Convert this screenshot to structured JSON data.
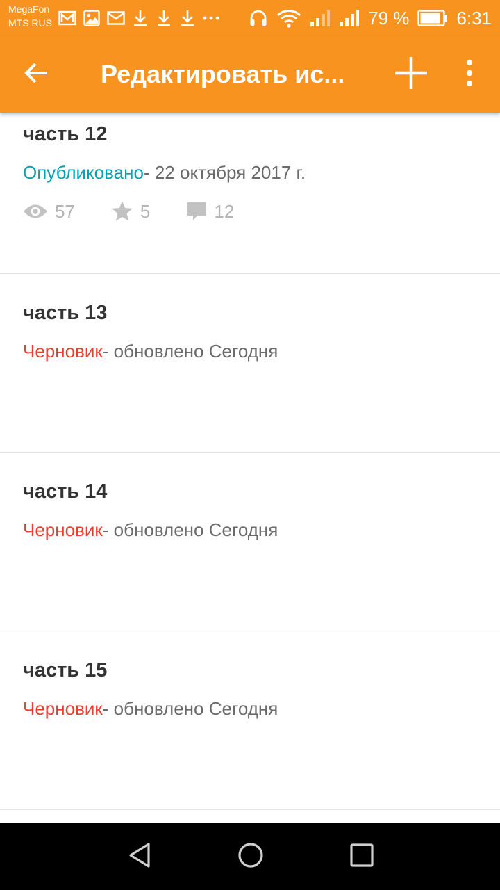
{
  "status_bar": {
    "carrier_1": "MegaFon",
    "carrier_2": "MTS RUS",
    "battery_percent": "79 %",
    "time": "6:31",
    "icons": [
      "gmail-icon",
      "image-icon",
      "mail-icon",
      "download-icon",
      "download-icon",
      "download-icon",
      "more-notifications-icon",
      "headset-icon",
      "wifi-icon",
      "signal-icon",
      "signal-icon",
      "battery-icon"
    ]
  },
  "toolbar": {
    "title": "Редактировать ис...",
    "icons": [
      "back-arrow-icon",
      "add-icon",
      "more-vert-icon"
    ]
  },
  "parts": [
    {
      "title": "часть 12",
      "status": "Опубликовано",
      "status_suffix": "- 22 октября 2017 г.",
      "stats": {
        "views": "57",
        "votes": "5",
        "comments": "12"
      }
    },
    {
      "title": "часть 13",
      "status": "Черновик",
      "status_suffix": "- обновлено Сегодня"
    },
    {
      "title": "часть 14",
      "status": "Черновик",
      "status_suffix": "- обновлено Сегодня"
    },
    {
      "title": "часть 15",
      "status": "Черновик",
      "status_suffix": "- обновлено Сегодня"
    }
  ],
  "colors": {
    "accent": "#f7931e",
    "published": "#00a3b5",
    "draft": "#ef3b2c",
    "title_text": "#333333",
    "secondary_text": "#6b6b6b",
    "stat_text": "#b5b5b5"
  },
  "nav_bar": {
    "icons": [
      "back-triangle-icon",
      "home-circle-icon",
      "recents-square-icon"
    ]
  }
}
